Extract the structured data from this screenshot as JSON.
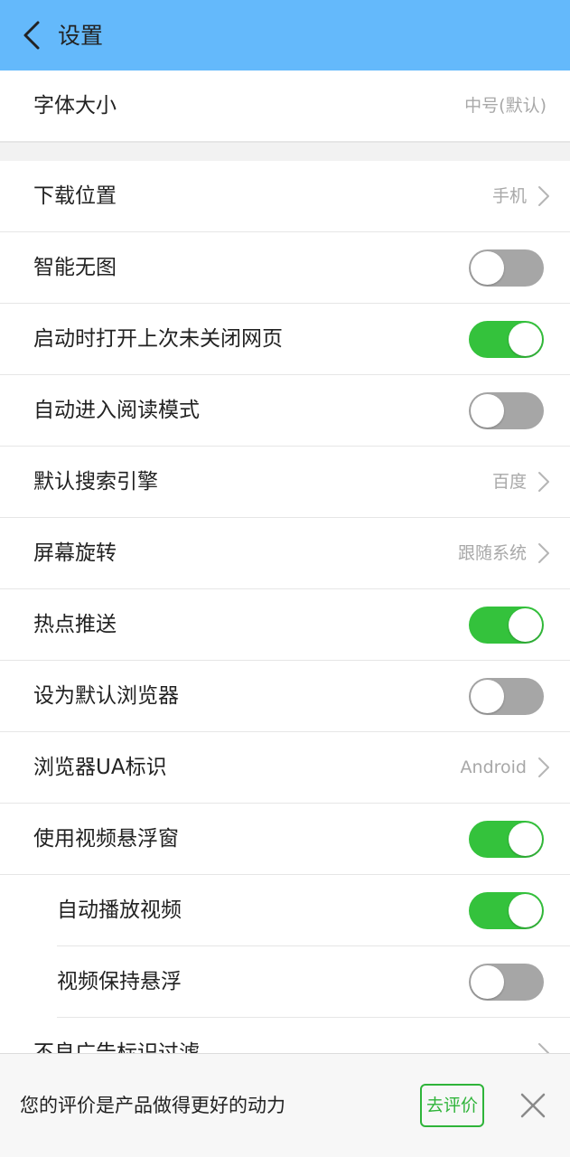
{
  "header": {
    "title": "设置"
  },
  "settings": [
    {
      "label": "字体大小",
      "type": "value",
      "value": "中号(默认)",
      "chevron": false
    },
    {
      "type": "gap"
    },
    {
      "label": "下载位置",
      "type": "value",
      "value": "手机",
      "chevron": true
    },
    {
      "label": "智能无图",
      "type": "toggle",
      "on": false
    },
    {
      "label": "启动时打开上次未关闭网页",
      "type": "toggle",
      "on": true
    },
    {
      "label": "自动进入阅读模式",
      "type": "toggle",
      "on": false
    },
    {
      "label": "默认搜索引擎",
      "type": "value",
      "value": "百度",
      "chevron": true
    },
    {
      "label": "屏幕旋转",
      "type": "value",
      "value": "跟随系统",
      "chevron": true
    },
    {
      "label": "热点推送",
      "type": "toggle",
      "on": true
    },
    {
      "label": "设为默认浏览器",
      "type": "toggle",
      "on": false
    },
    {
      "label": "浏览器UA标识",
      "type": "value",
      "value": "Android",
      "chevron": true
    },
    {
      "label": "使用视频悬浮窗",
      "type": "toggle",
      "on": true
    },
    {
      "label": "自动播放视频",
      "type": "toggle",
      "on": true,
      "indent": true
    },
    {
      "label": "视频保持悬浮",
      "type": "toggle",
      "on": false,
      "indent": true
    },
    {
      "label": "不良广告标识过滤",
      "type": "value",
      "value": "",
      "chevron": true
    }
  ],
  "rate_bar": {
    "text": "您的评价是产品做得更好的动力",
    "button_label": "去评价"
  },
  "colors": {
    "header": "#64b9fb",
    "toggle_on": "#34c23c",
    "toggle_off": "#a6a6a6",
    "rate_button": "#2fb43a"
  }
}
